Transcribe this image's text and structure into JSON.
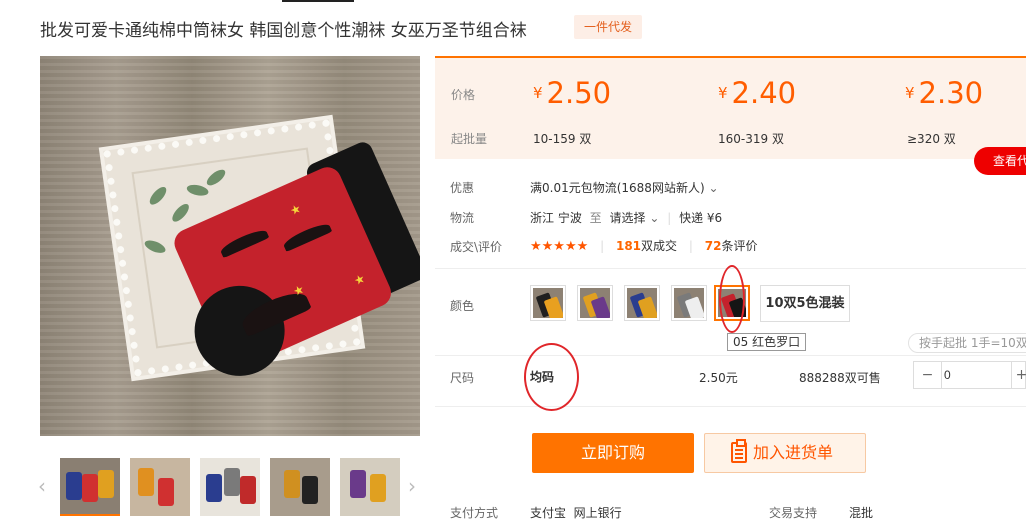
{
  "product": {
    "title": "批发可爱卡通纯棉中筒袜女 韩国创意个性潮袜 女巫万圣节组合袜",
    "badge": "一件代发"
  },
  "gallery": {
    "zoom_icon": "search-icon",
    "prev_icon": "chevron-left-icon",
    "next_icon": "chevron-right-icon",
    "thumbnail_count": 5
  },
  "price_panel": {
    "price_label": "价格",
    "min_batch_label": "起批量",
    "tiers": [
      {
        "currency": "¥",
        "price": "2.50",
        "range": "10-159 双"
      },
      {
        "currency": "¥",
        "price": "2.40",
        "range": "160-319 双"
      },
      {
        "currency": "¥",
        "price": "2.30",
        "range": "≥320 双"
      }
    ],
    "view_button": "查看代"
  },
  "info": {
    "promo_label": "优惠",
    "promo_text": "满0.01元包物流(1688网站新人)",
    "logistics_label": "物流",
    "origin": "浙江 宁波",
    "to": "至",
    "destination": "请选择",
    "express": "快递 ¥6",
    "deal_label": "成交\\评价",
    "stars": "★★★★★",
    "deal_count": "181",
    "deal_suffix": "双成交",
    "review_count": "72",
    "review_suffix": "条评价"
  },
  "color": {
    "label": "颜色",
    "selected_index": 4,
    "tooltip": "05 红色罗口",
    "mix_option": "10双5色混装"
  },
  "batch_tip": "按手起批 1手=10双",
  "size": {
    "label": "尺码",
    "value": "均码",
    "price": "2.50元",
    "stock": "888288双可售",
    "quantity": "0",
    "minus": "−",
    "plus": "+"
  },
  "actions": {
    "buy_now": "立即订购",
    "add_to_cart": "加入进货单"
  },
  "footer": {
    "payment_label": "支付方式",
    "payment_methods": "支付宝  网上银行",
    "support_label": "交易支持",
    "support_value": "混批"
  },
  "colors": {
    "accent": "#ff7300",
    "price": "#ff5d00",
    "annotation": "#e0262a"
  }
}
